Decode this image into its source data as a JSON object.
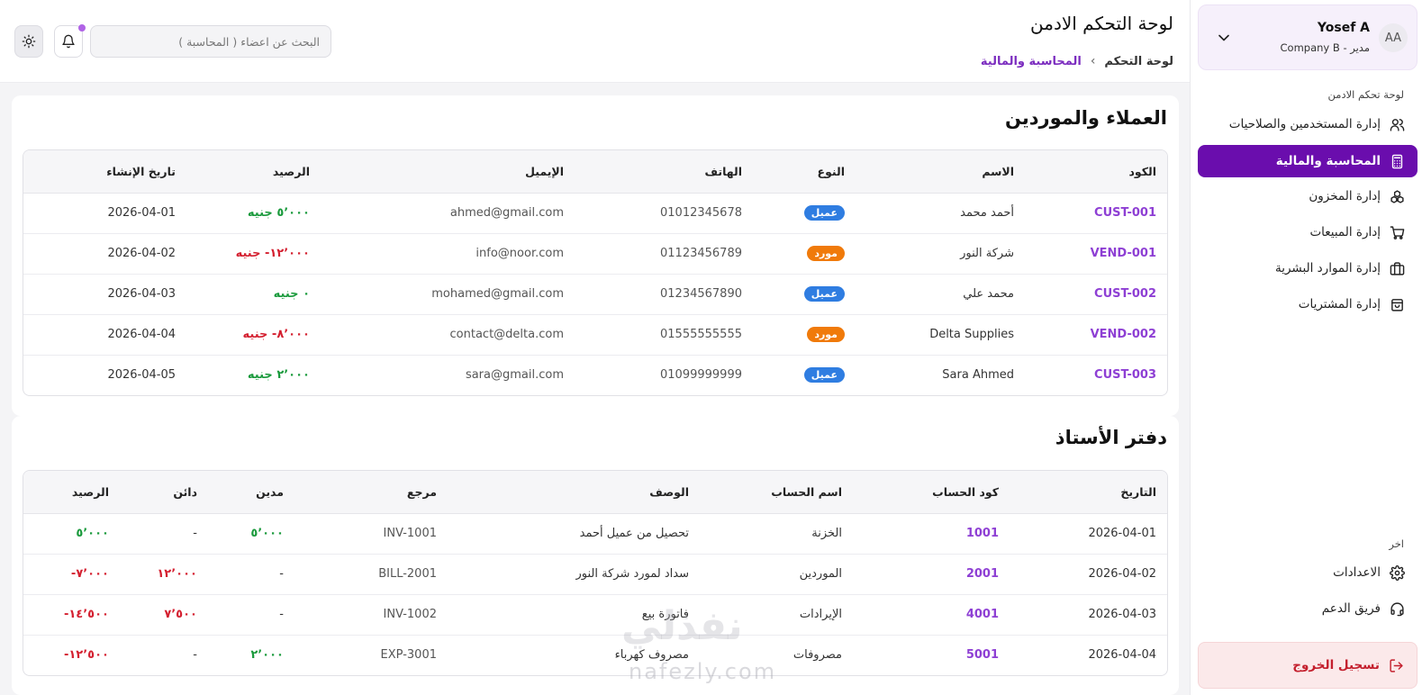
{
  "header": {
    "title": "لوحة التحكم الادمن",
    "breadcrumb": [
      "لوحة التحكم",
      "المحاسبة والمالية"
    ],
    "search_placeholder": "البحث عن اعضاء ( المحاسبة )"
  },
  "user": {
    "initials": "AA",
    "name": "Yosef A",
    "role": "مدير - Company B"
  },
  "sidebar": {
    "section_main": "لوحة تحكم الادمن",
    "items": [
      {
        "label": "إدارة المستخدمين والصلاحيات",
        "icon": "users-icon"
      },
      {
        "label": "المحاسبة والمالية",
        "icon": "calculator-icon",
        "active": true
      },
      {
        "label": "إدارة المخزون",
        "icon": "boxes-icon"
      },
      {
        "label": "إدارة المبيعات",
        "icon": "cart-icon"
      },
      {
        "label": "إدارة الموارد البشرية",
        "icon": "briefcase-icon"
      },
      {
        "label": "إدارة المشتريات",
        "icon": "shopping-bag-icon"
      }
    ],
    "section_other": "اخر",
    "other_items": [
      {
        "label": "الاعدادات",
        "icon": "gear-icon"
      },
      {
        "label": "فريق الدعم",
        "icon": "headset-icon"
      }
    ],
    "logout_label": "تسجيل الخروج"
  },
  "customers": {
    "title": "العملاء والموردين",
    "columns": [
      "الكود",
      "الاسم",
      "النوع",
      "الهاتف",
      "الإيميل",
      "الرصيد",
      "تاريخ الإنشاء"
    ],
    "rows": [
      {
        "code": "CUST-001",
        "name": "أحمد محمد",
        "type": "عميل",
        "kind": "client",
        "phone": "01012345678",
        "email": "ahmed@gmail.com",
        "balance": "٥٬٠٠٠ جنيه",
        "positive": true,
        "date": "2026-04-01"
      },
      {
        "code": "VEND-001",
        "name": "شركة النور",
        "type": "مورد",
        "kind": "vendor",
        "phone": "01123456789",
        "email": "info@noor.com",
        "balance": "١٢٬٠٠٠- جنيه",
        "positive": false,
        "date": "2026-04-02"
      },
      {
        "code": "CUST-002",
        "name": "محمد علي",
        "type": "عميل",
        "kind": "client",
        "phone": "01234567890",
        "email": "mohamed@gmail.com",
        "balance": "٠ جنيه",
        "positive": true,
        "date": "2026-04-03"
      },
      {
        "code": "VEND-002",
        "name": "Delta Supplies",
        "type": "مورد",
        "kind": "vendor",
        "phone": "01555555555",
        "email": "contact@delta.com",
        "balance": "٨٬٠٠٠- جنيه",
        "positive": false,
        "date": "2026-04-04"
      },
      {
        "code": "CUST-003",
        "name": "Sara Ahmed",
        "type": "عميل",
        "kind": "client",
        "phone": "01099999999",
        "email": "sara@gmail.com",
        "balance": "٢٬٠٠٠ جنيه",
        "positive": true,
        "date": "2026-04-05"
      }
    ]
  },
  "ledger": {
    "title": "دفتر الأستاذ",
    "columns": [
      "التاريخ",
      "كود الحساب",
      "اسم الحساب",
      "الوصف",
      "مرجع",
      "مدين",
      "دائن",
      "الرصيد"
    ],
    "rows": [
      {
        "date": "2026-04-01",
        "account_code": "1001",
        "account_name": "الخزنة",
        "description": "تحصيل من عميل أحمد",
        "ref": "INV-1001",
        "debit": "٥٬٠٠٠",
        "credit": "-",
        "balance": "٥٬٠٠٠",
        "balance_positive": true
      },
      {
        "date": "2026-04-02",
        "account_code": "2001",
        "account_name": "الموردين",
        "description": "سداد لمورد شركة النور",
        "ref": "BILL-2001",
        "debit": "-",
        "credit": "١٢٬٠٠٠",
        "balance": "٧٬٠٠٠-",
        "balance_positive": false
      },
      {
        "date": "2026-04-03",
        "account_code": "4001",
        "account_name": "الإيرادات",
        "description": "فاتورة بيع",
        "ref": "INV-1002",
        "debit": "-",
        "credit": "٧٬٥٠٠",
        "balance": "١٤٬٥٠٠-",
        "balance_positive": false
      },
      {
        "date": "2026-04-04",
        "account_code": "5001",
        "account_name": "مصروفات",
        "description": "مصروف كهرباء",
        "ref": "EXP-3001",
        "debit": "٢٬٠٠٠",
        "credit": "-",
        "balance": "١٢٬٥٠٠-",
        "balance_positive": false
      }
    ]
  },
  "watermark": {
    "arabic": "نفذلي",
    "latin": "nafezly.com"
  },
  "colors": {
    "accent": "#6a0dad",
    "code_text": "#8e3fd4",
    "positive": "#1a9a3c",
    "negative": "#d42030",
    "badge_client": "#2f7de1",
    "badge_vendor": "#f07a0a",
    "logout_bg": "#fbe9ea"
  }
}
